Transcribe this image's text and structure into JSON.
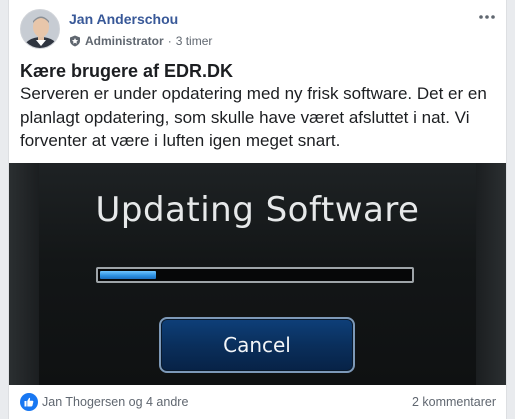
{
  "post": {
    "author": "Jan Anderschou",
    "role": "Administrator",
    "separator": "·",
    "time": "3 timer",
    "headline": "Kære brugere af EDR.DK",
    "message": "Serveren er under opdatering med ny frisk software. Det er en planlagt opdatering, som skulle have været afsluttet i nat. Vi forventer at være i luften igen meget snart.",
    "icons": {
      "badge": "admin-badge-icon",
      "more": "more-options-icon",
      "like": "like-icon"
    }
  },
  "media": {
    "title": "Updating Software",
    "progress_fraction": 0.18,
    "cancel_label": "Cancel"
  },
  "footer": {
    "reactions_text": "Jan Thogersen og 4 andre",
    "comments_text": "2 kommentarer"
  },
  "colors": {
    "link": "#385898",
    "like_blue": "#1877f2",
    "progress": "#2b8fe0"
  }
}
